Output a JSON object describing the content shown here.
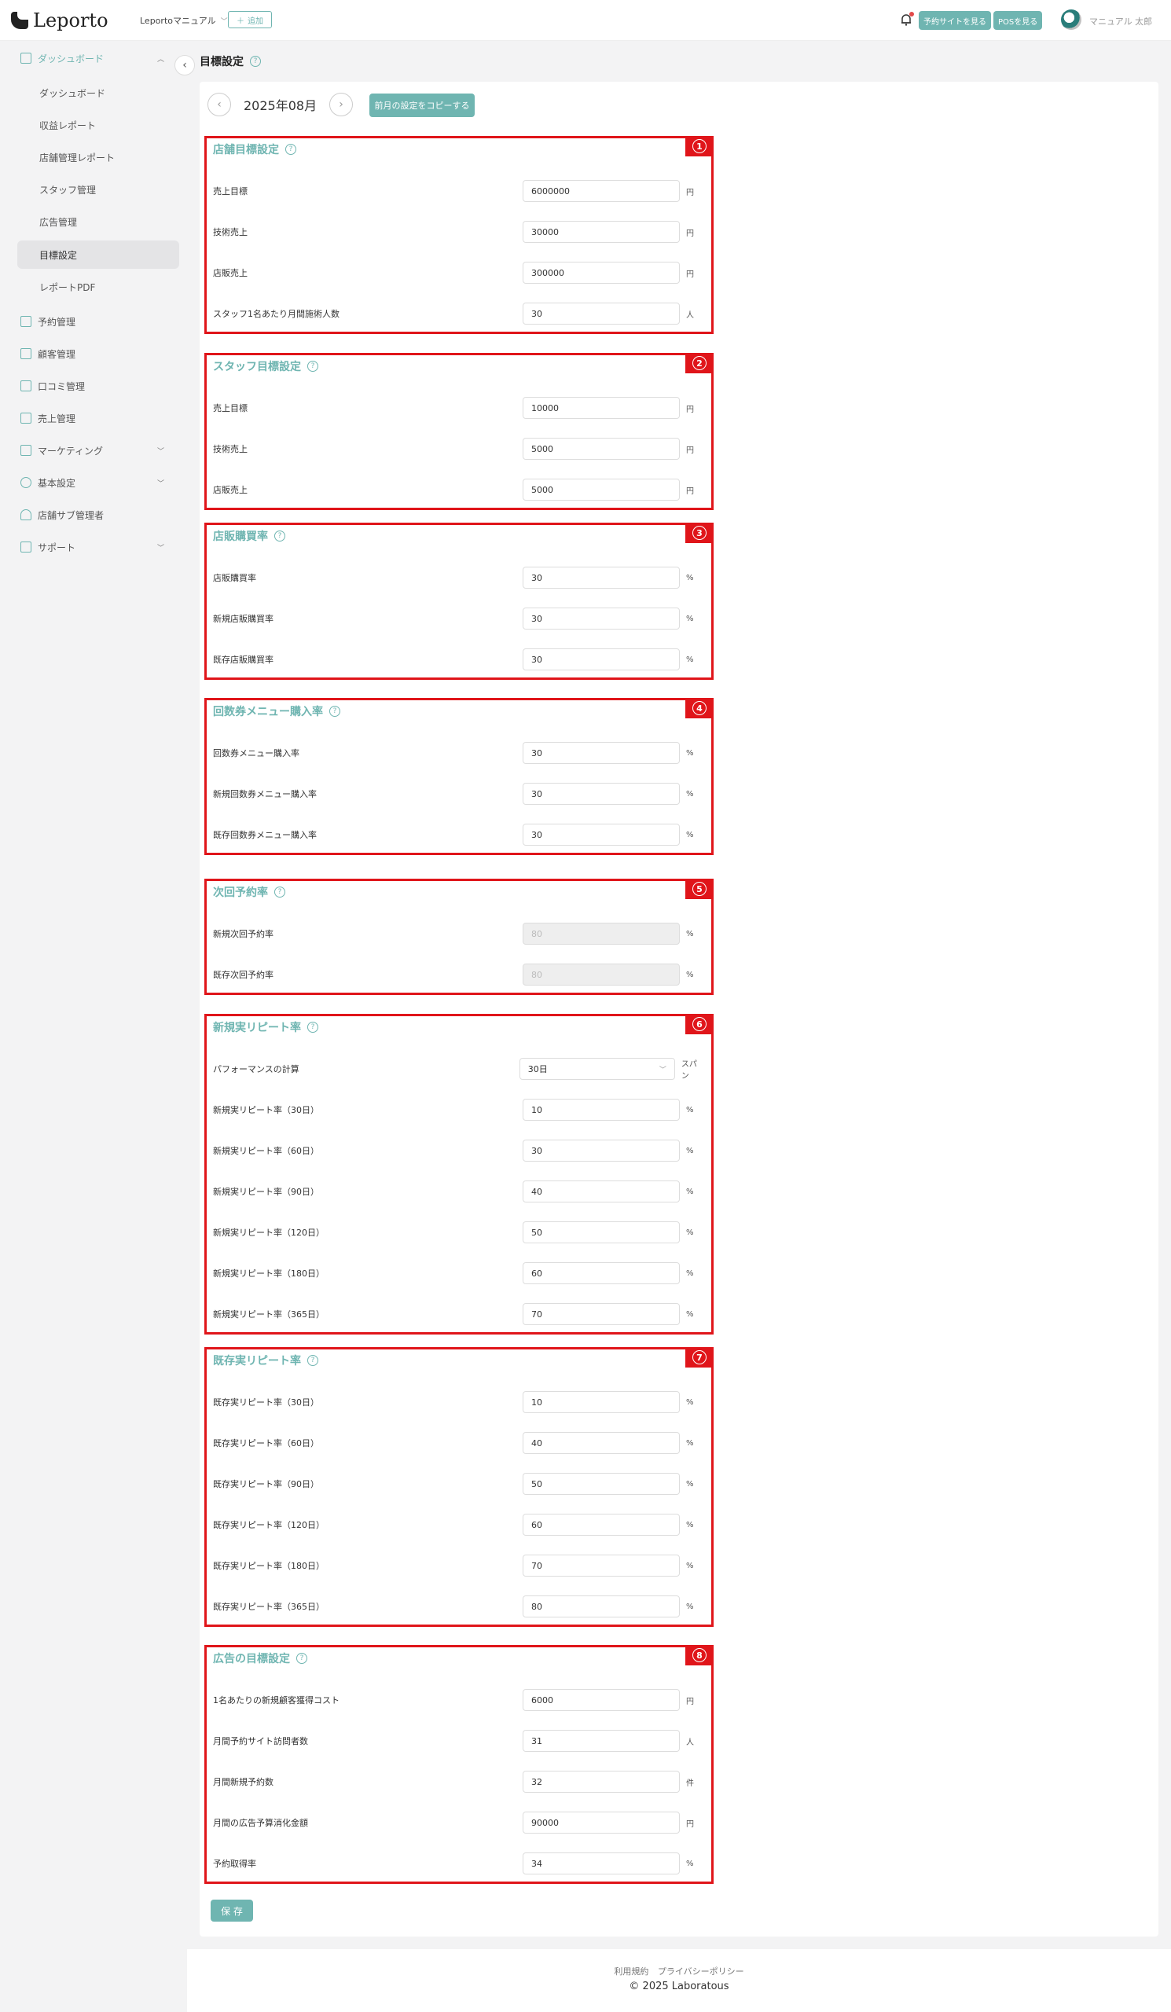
{
  "header": {
    "logo_text": "Leporto",
    "store_select": "Leportoマニュアル",
    "add_label": "追加",
    "reservation_site_label": "予約サイトを見る",
    "pos_label": "POSを見る",
    "username": "マニュアル 太郎"
  },
  "sidebar": {
    "items": [
      {
        "label": "ダッシュボード"
      },
      {
        "label": "予約管理"
      },
      {
        "label": "顧客管理"
      },
      {
        "label": "口コミ管理"
      },
      {
        "label": "売上管理"
      },
      {
        "label": "マーケティング"
      },
      {
        "label": "基本設定"
      },
      {
        "label": "店舗サブ管理者"
      },
      {
        "label": "サポート"
      }
    ],
    "sub_items": [
      {
        "label": "ダッシュボード"
      },
      {
        "label": "収益レポート"
      },
      {
        "label": "店舗管理レポート"
      },
      {
        "label": "スタッフ管理"
      },
      {
        "label": "広告管理"
      },
      {
        "label": "目標設定"
      },
      {
        "label": "レポートPDF"
      }
    ]
  },
  "page": {
    "title": "目標設定",
    "month": "2025年08月",
    "copy_button": "前月の設定をコピーする",
    "save_button": "保 存"
  },
  "sections": [
    {
      "num": "1",
      "title": "店舗目標設定",
      "rows": [
        {
          "label": "売上目標",
          "value": "6000000",
          "unit": "円"
        },
        {
          "label": "技術売上",
          "value": "30000",
          "unit": "円"
        },
        {
          "label": "店販売上",
          "value": "300000",
          "unit": "円"
        },
        {
          "label": "スタッフ1名あたり月間施術人数",
          "value": "30",
          "unit": "人"
        }
      ]
    },
    {
      "num": "2",
      "title": "スタッフ目標設定",
      "rows": [
        {
          "label": "売上目標",
          "value": "10000",
          "unit": "円"
        },
        {
          "label": "技術売上",
          "value": "5000",
          "unit": "円"
        },
        {
          "label": "店販売上",
          "value": "5000",
          "unit": "円"
        }
      ]
    },
    {
      "num": "3",
      "title": "店販購買率",
      "rows": [
        {
          "label": "店販購買率",
          "value": "30",
          "unit": "%"
        },
        {
          "label": "新規店販購買率",
          "value": "30",
          "unit": "%"
        },
        {
          "label": "既存店販購買率",
          "value": "30",
          "unit": "%"
        }
      ]
    },
    {
      "num": "4",
      "title": "回数券メニュー購入率",
      "rows": [
        {
          "label": "回数券メニュー購入率",
          "value": "30",
          "unit": "%"
        },
        {
          "label": "新規回数券メニュー購入率",
          "value": "30",
          "unit": "%"
        },
        {
          "label": "既存回数券メニュー購入率",
          "value": "30",
          "unit": "%"
        }
      ]
    },
    {
      "num": "5",
      "title": "次回予約率",
      "rows": [
        {
          "label": "新規次回予約率",
          "value": "80",
          "unit": "%",
          "disabled": true
        },
        {
          "label": "既存次回予約率",
          "value": "80",
          "unit": "%",
          "disabled": true
        }
      ]
    },
    {
      "num": "6",
      "title": "新規実リピート率",
      "rows": [
        {
          "label": "パフォーマンスの計算",
          "value": "30日",
          "unit": "スパン",
          "select": true
        },
        {
          "label": "新規実リピート率（30日）",
          "value": "10",
          "unit": "%"
        },
        {
          "label": "新規実リピート率（60日）",
          "value": "30",
          "unit": "%"
        },
        {
          "label": "新規実リピート率（90日）",
          "value": "40",
          "unit": "%"
        },
        {
          "label": "新規実リピート率（120日）",
          "value": "50",
          "unit": "%"
        },
        {
          "label": "新規実リピート率（180日）",
          "value": "60",
          "unit": "%"
        },
        {
          "label": "新規実リピート率（365日）",
          "value": "70",
          "unit": "%"
        }
      ]
    },
    {
      "num": "7",
      "title": "既存実リピート率",
      "rows": [
        {
          "label": "既存実リピート率（30日）",
          "value": "10",
          "unit": "%"
        },
        {
          "label": "既存実リピート率（60日）",
          "value": "40",
          "unit": "%"
        },
        {
          "label": "既存実リピート率（90日）",
          "value": "50",
          "unit": "%"
        },
        {
          "label": "既存実リピート率（120日）",
          "value": "60",
          "unit": "%"
        },
        {
          "label": "既存実リピート率（180日）",
          "value": "70",
          "unit": "%"
        },
        {
          "label": "既存実リピート率（365日）",
          "value": "80",
          "unit": "%"
        }
      ]
    },
    {
      "num": "8",
      "title": "広告の目標設定",
      "rows": [
        {
          "label": "1名あたりの新規顧客獲得コスト",
          "value": "6000",
          "unit": "円"
        },
        {
          "label": "月間予約サイト訪問者数",
          "value": "31",
          "unit": "人"
        },
        {
          "label": "月間新規予約数",
          "value": "32",
          "unit": "件"
        },
        {
          "label": "月間の広告予算消化金額",
          "value": "90000",
          "unit": "円"
        },
        {
          "label": "予約取得率",
          "value": "34",
          "unit": "%"
        }
      ]
    }
  ],
  "footer": {
    "terms": "利用規約",
    "privacy": "プライバシーポリシー",
    "copyright": "© 2025 Laboratous"
  }
}
